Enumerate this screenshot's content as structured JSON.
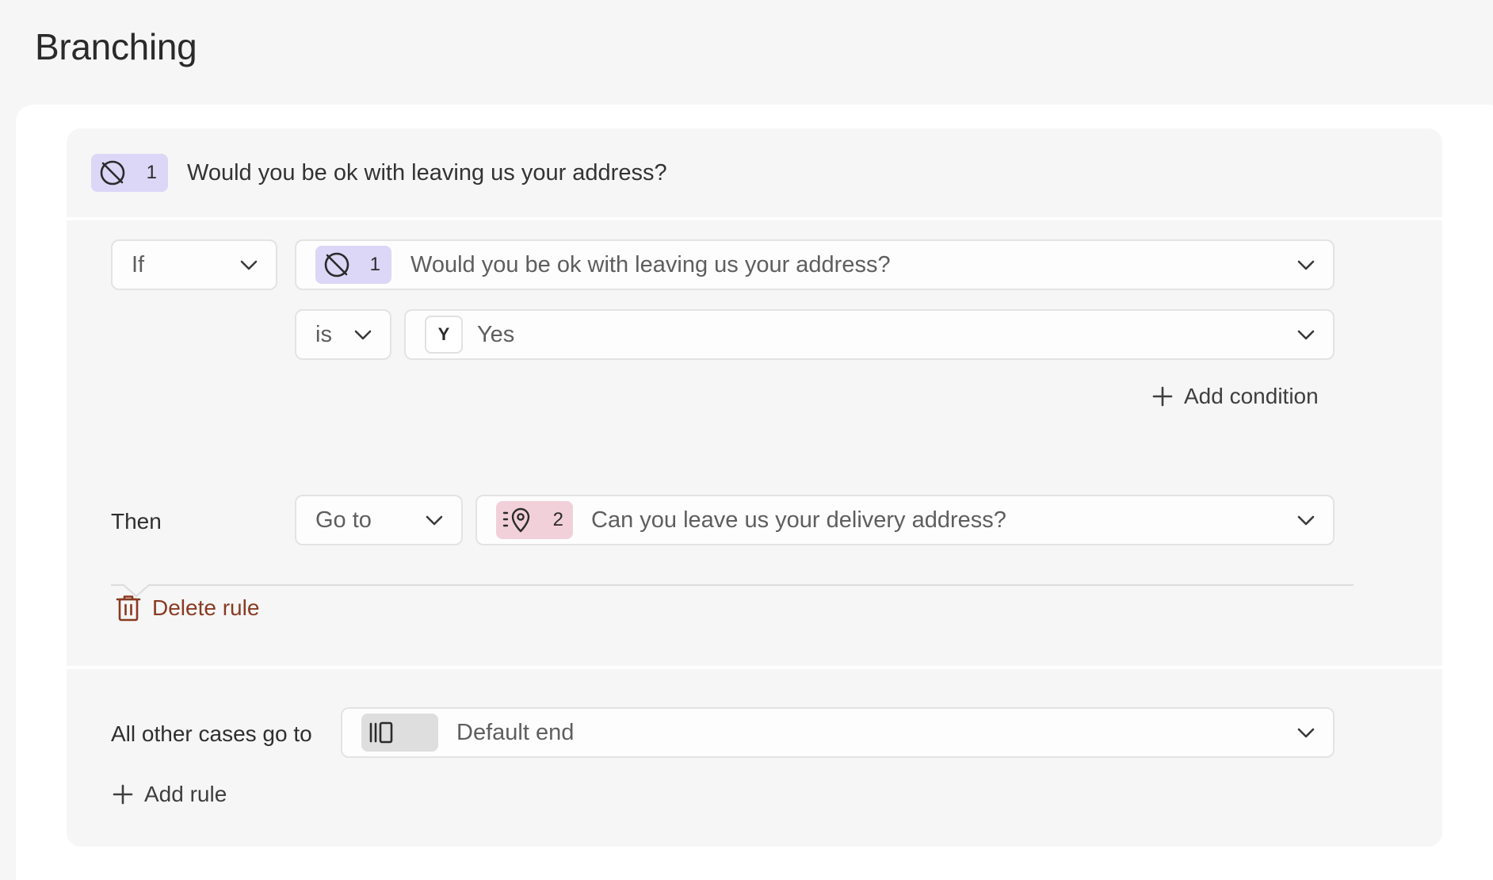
{
  "page": {
    "title": "Branching"
  },
  "question": {
    "number": "1",
    "text": "Would you be ok with leaving us your address?",
    "icon": "circle-slash-icon"
  },
  "rule": {
    "if_label": "If",
    "condition_question": {
      "number": "1",
      "text": "Would you be ok with leaving us your address?"
    },
    "operator": "is",
    "value": {
      "key": "Y",
      "text": "Yes"
    },
    "add_condition_label": "Add condition",
    "then_label": "Then",
    "action": "Go to",
    "target": {
      "number": "2",
      "text": "Can you leave us your delivery address?",
      "icon": "location-pin-icon"
    },
    "delete_label": "Delete rule"
  },
  "fallback": {
    "label": "All other cases go to",
    "target_text": "Default end",
    "icon": "end-screen-icon"
  },
  "add_rule_label": "Add rule",
  "colors": {
    "question_badge": "#dcd6f7",
    "pin_badge": "#f2d0da",
    "end_badge": "#dedede",
    "danger": "#8a3a22"
  }
}
